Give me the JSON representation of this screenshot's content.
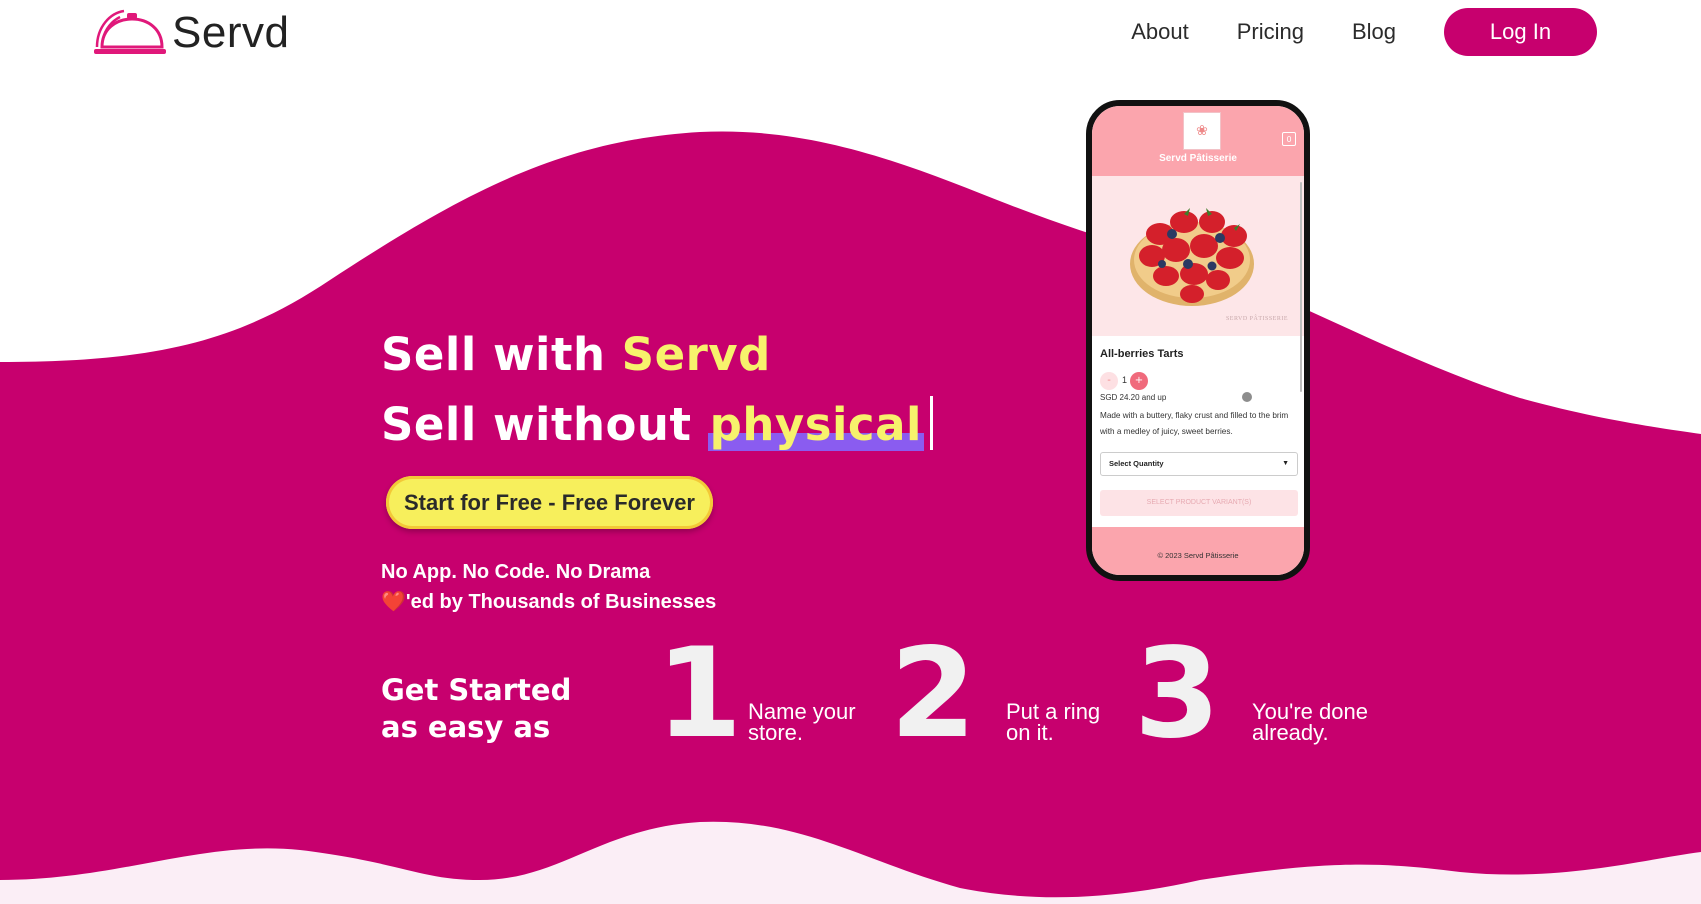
{
  "colors": {
    "brand": "#c7006e",
    "accent_yellow": "#f7f26c",
    "text_dark": "#2b2b2b",
    "wave_light": "#fbeef6"
  },
  "header": {
    "logo_text": "Servd",
    "nav": {
      "about": "About",
      "pricing": "Pricing",
      "blog": "Blog"
    },
    "login_label": "Log In"
  },
  "hero": {
    "line1_prefix": "Sell with ",
    "line1_highlight": "Servd",
    "line2_prefix": "Sell without ",
    "line2_typed": "physical",
    "cta_label": "Start for Free - Free Forever",
    "tagline1": "No App. No Code. No Drama",
    "tagline2_icon": "❤️",
    "tagline2": "'ed by Thousands of Businesses"
  },
  "steps": {
    "heading_line1": "Get Started",
    "heading_line2": "as easy as",
    "items": [
      {
        "num": "1",
        "line1": "Name your",
        "line2": "store."
      },
      {
        "num": "2",
        "line1": "Put a ring",
        "line2": "on it."
      },
      {
        "num": "3",
        "line1": "You're done",
        "line2": "already."
      }
    ]
  },
  "phone": {
    "store_name": "Servd Pâtisserie",
    "image_watermark": "SERVD PÂTISSERIE",
    "product_title": "All-berries Tarts",
    "qty_minus": "-",
    "qty_value": "1",
    "qty_plus": "+",
    "price": "SGD 24.20 and up",
    "description": "Made with a buttery, flaky crust and filled to the brim with a medley of juicy, sweet berries.",
    "select_label": "Select Quantity",
    "variant_button": "SELECT PRODUCT VARIANT(S)",
    "footer": "© 2023 Servd Pâtisserie"
  }
}
